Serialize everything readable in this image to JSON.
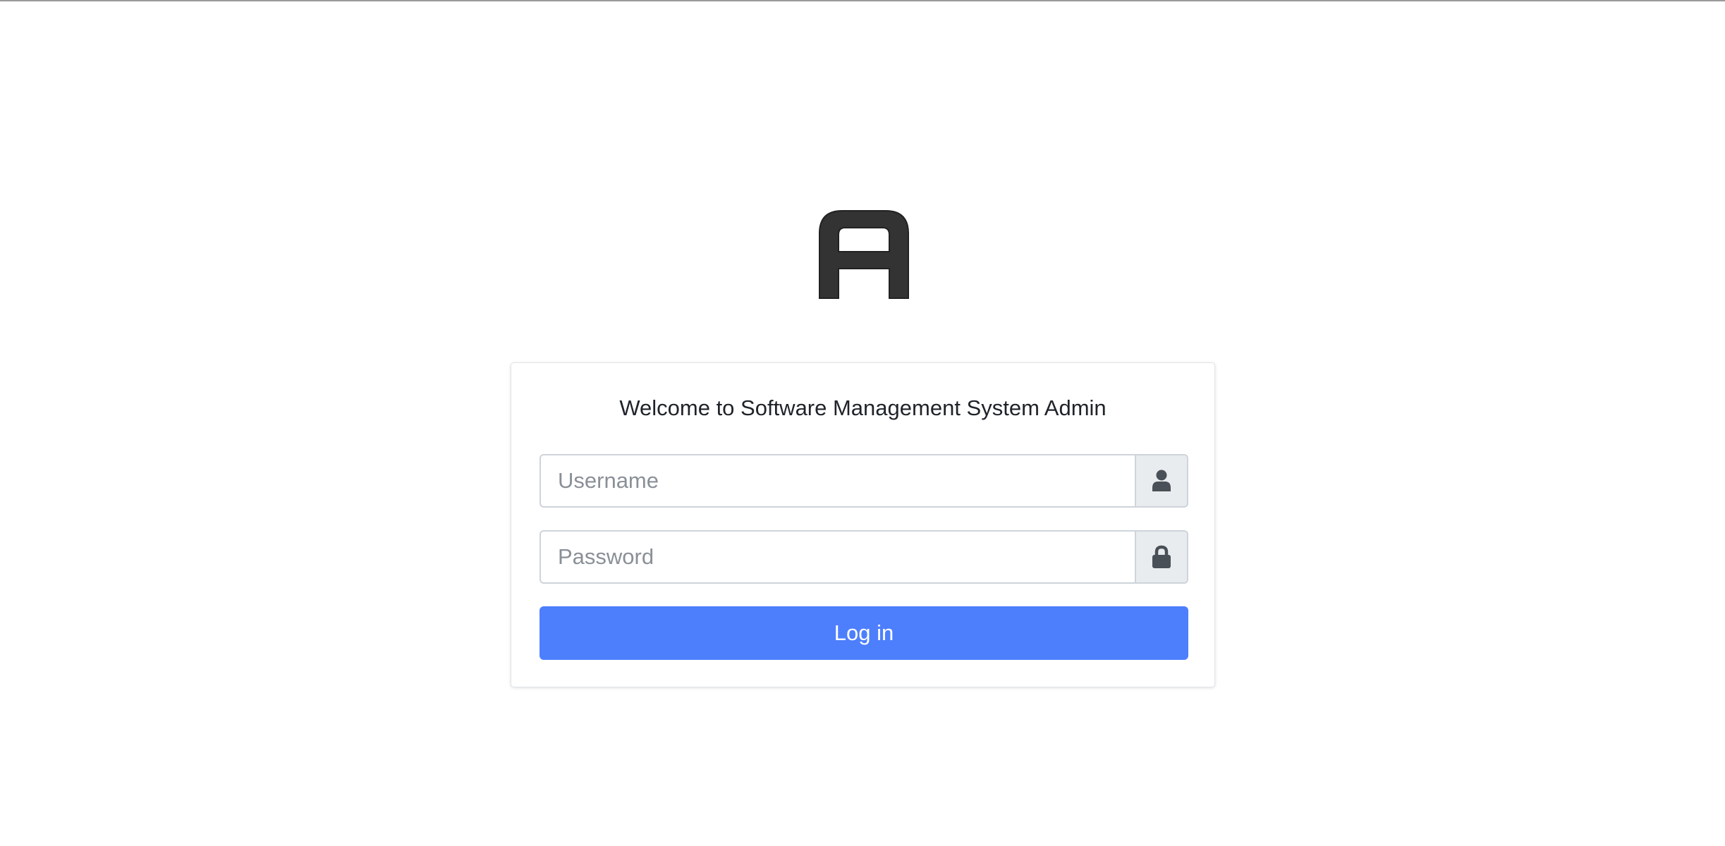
{
  "logo": {
    "icon": "letter-a-logo",
    "color": "#333333"
  },
  "login": {
    "welcome_text": "Welcome to Software Management System Admin",
    "username": {
      "placeholder": "Username",
      "value": "",
      "icon": "user-icon"
    },
    "password": {
      "placeholder": "Password",
      "value": "",
      "icon": "lock-icon"
    },
    "submit_label": "Log in",
    "accent_color": "#4d7ffd"
  }
}
